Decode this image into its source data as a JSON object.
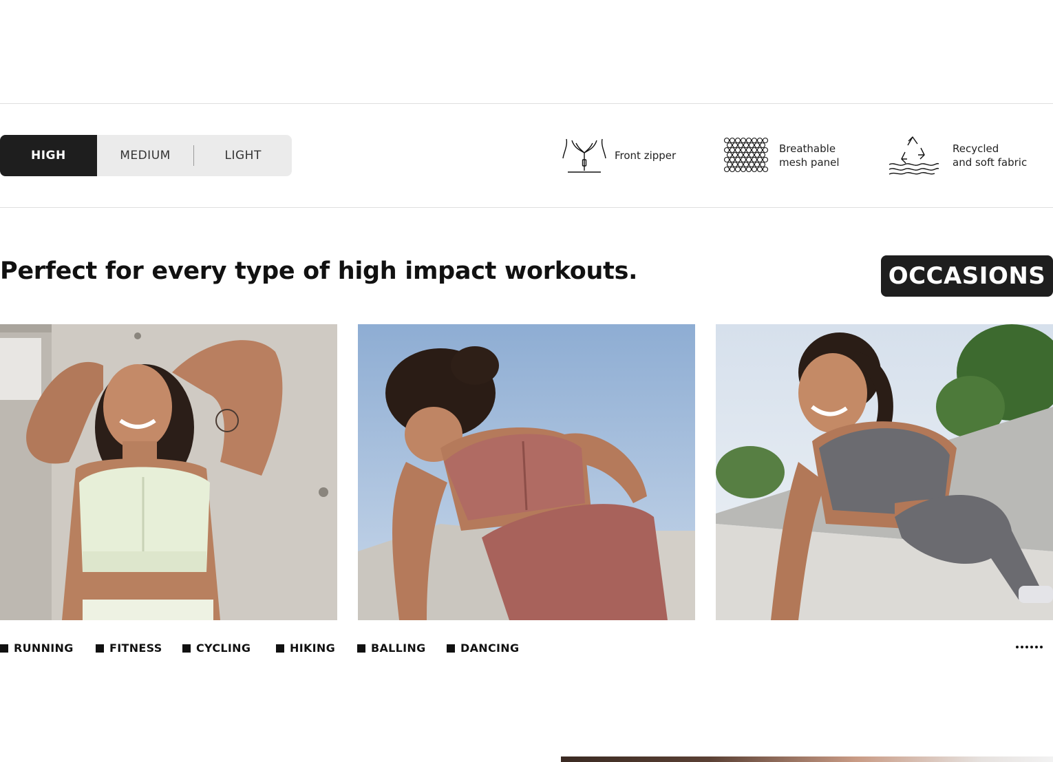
{
  "impact_levels": {
    "high": "HIGH",
    "medium": "MEDIUM",
    "light": "LIGHT",
    "selected": "HIGH"
  },
  "features": [
    {
      "icon": "zipper-icon",
      "line1": "Front zipper",
      "line2": ""
    },
    {
      "icon": "mesh-icon",
      "line1": "Breathable",
      "line2": "mesh panel"
    },
    {
      "icon": "recycle-icon",
      "line1": "Recycled",
      "line2": "and soft fabric"
    }
  ],
  "headline": "Perfect for every type of high impact workouts.",
  "badge": "OCCASIONS",
  "photos": [
    {
      "name": "model-white-bra",
      "bra_color": "#e7efd8"
    },
    {
      "name": "model-pink-bra",
      "bra_color": "#b06b63"
    },
    {
      "name": "model-grey-bra",
      "bra_color": "#6b6b70"
    }
  ],
  "activities": [
    "RUNNING",
    "FITNESS",
    "CYCLING",
    "HIKING",
    "BALLING",
    "DANCING"
  ],
  "colors": {
    "dark": "#1e1e1e",
    "pill_bg": "#ebebeb",
    "rule": "#dedede"
  }
}
